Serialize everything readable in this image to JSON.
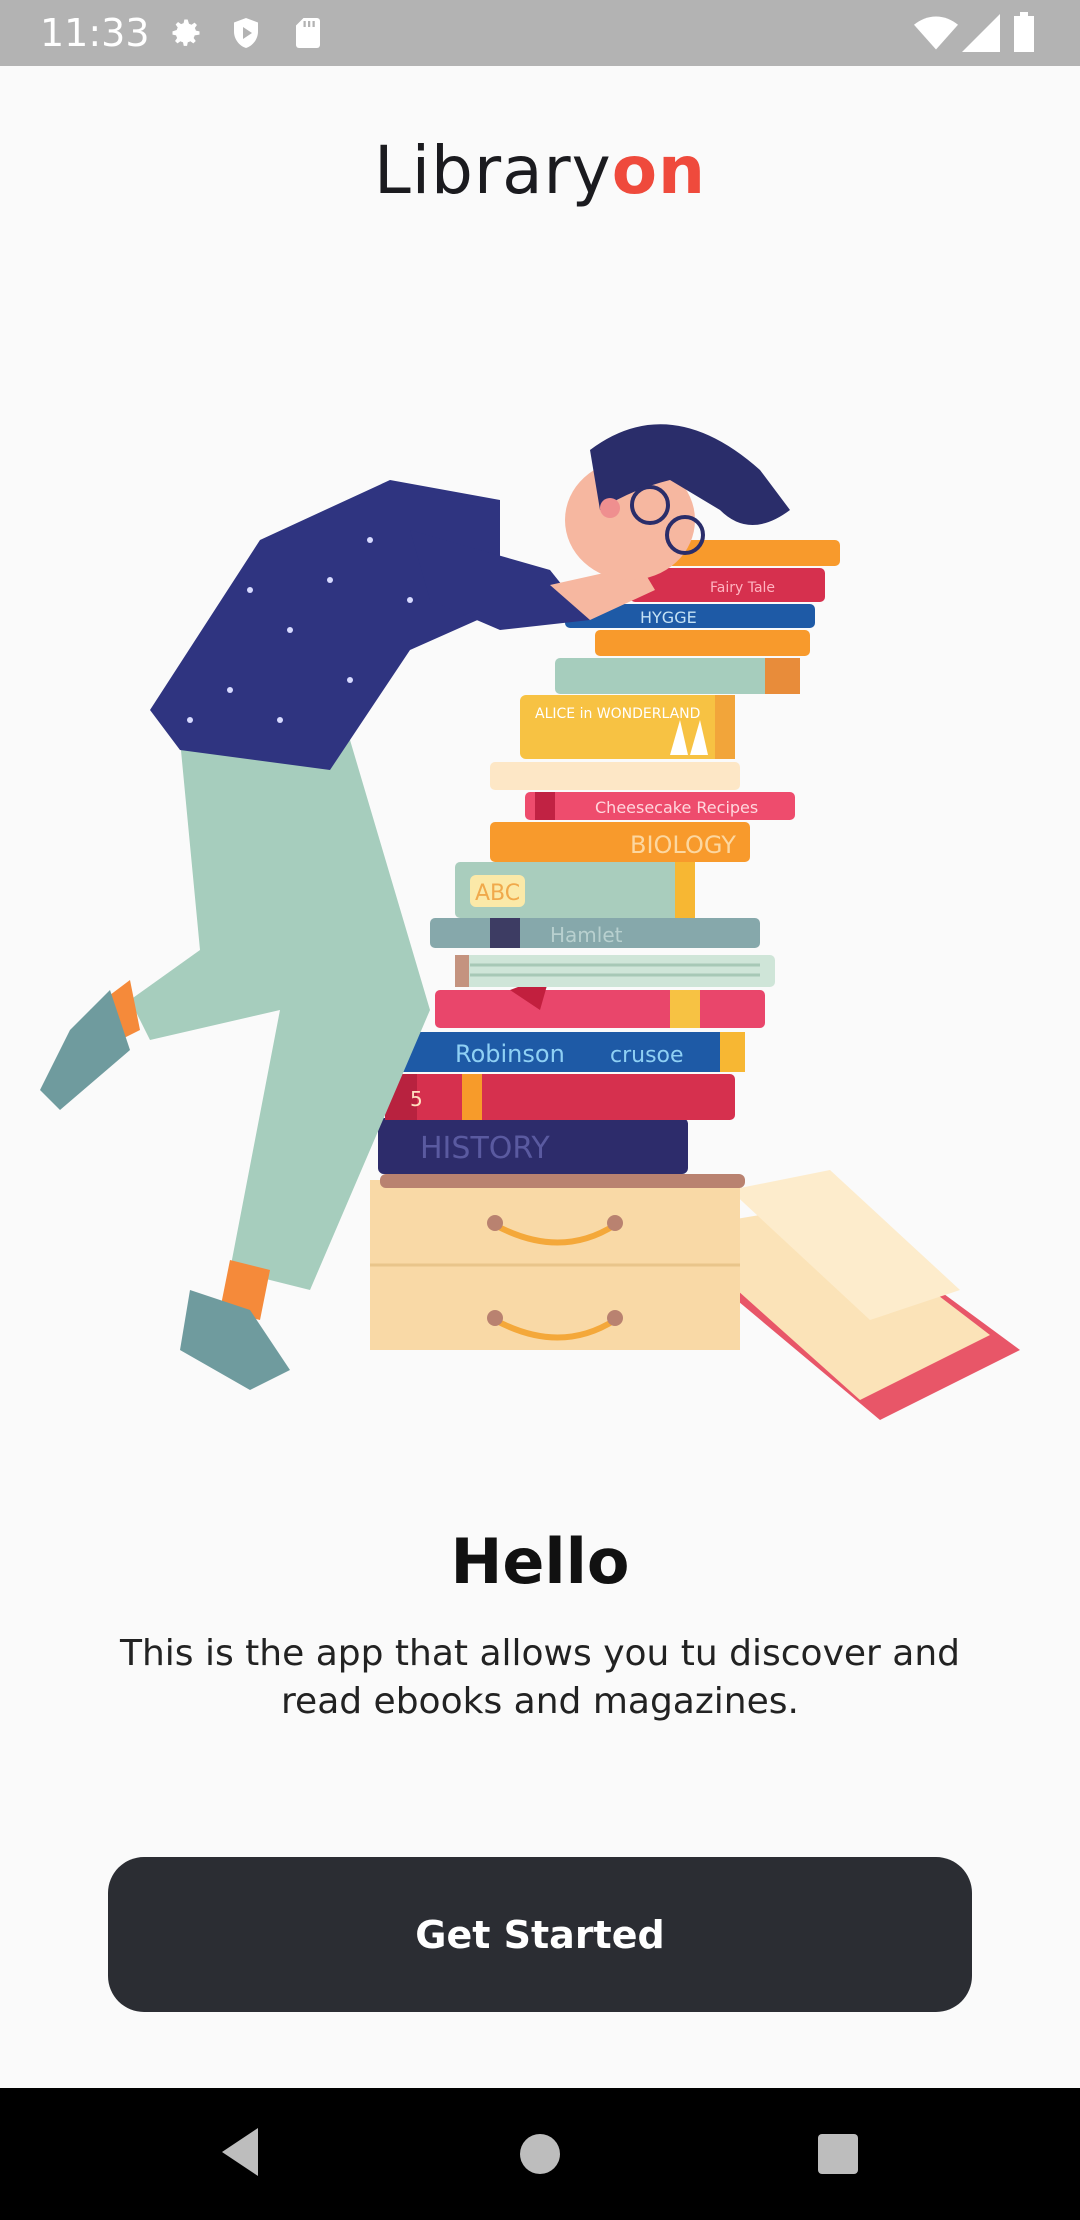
{
  "status_bar": {
    "time": "11:33",
    "left_icons": [
      "gear-icon",
      "shield-icon",
      "sd-card-icon"
    ],
    "right_icons": [
      "wifi-icon",
      "signal-icon",
      "battery-icon"
    ]
  },
  "logo": {
    "text_main": "Library",
    "text_accent": "on",
    "accent_color": "#ef4a3c"
  },
  "illustration": {
    "subject": "person-sleeping-on-book-stack",
    "book_spines": {
      "fairy_tale": "Fairy Tale",
      "hygge": "HYGGE",
      "alice": "ALICE in WONDERLAND",
      "cheesecake": "Cheesecake Recipes",
      "biology": "BIOLOGY",
      "abc": "ABC",
      "hamlet": "Hamlet",
      "robinson": "Robinson",
      "crusoe": "crusoe",
      "five": "5",
      "history": "HISTORY"
    }
  },
  "onboarding": {
    "title": "Hello",
    "description": "This is the app that allows you tu discover and read ebooks and magazines.",
    "cta_label": "Get Started"
  },
  "nav_bar": {
    "buttons": [
      "back-icon",
      "home-icon",
      "recents-icon"
    ]
  },
  "colors": {
    "background": "#fafafa",
    "button": "#2b2d33",
    "status_bar": "#b3b3b3",
    "nav_bar": "#000000"
  }
}
